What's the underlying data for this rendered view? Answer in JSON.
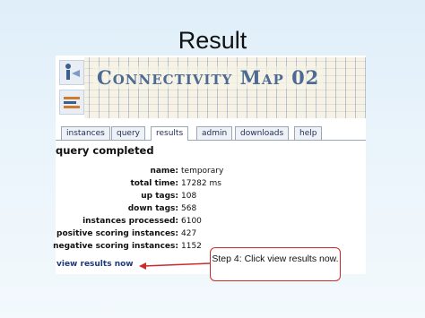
{
  "slide": {
    "title": "Result"
  },
  "app": {
    "brand": "Connectivity Map 02",
    "tabs": [
      {
        "label": "instances"
      },
      {
        "label": "query"
      },
      {
        "label": "results",
        "active": true
      },
      {
        "label": "admin"
      },
      {
        "label": "downloads"
      },
      {
        "label": "help"
      }
    ]
  },
  "results": {
    "heading": "query completed",
    "fields": [
      {
        "key": "name:",
        "value": "temporary"
      },
      {
        "key": "total time:",
        "value": "17282 ms"
      },
      {
        "key": "up tags:",
        "value": "108"
      },
      {
        "key": "down tags:",
        "value": "568"
      },
      {
        "key": "instances processed:",
        "value": "6100"
      },
      {
        "key": "positive scoring instances:",
        "value": "427"
      },
      {
        "key": "negative scoring instances:",
        "value": "1152"
      }
    ],
    "link": "view results now"
  },
  "callout": {
    "text": "Step 4: Click view results now."
  },
  "colors": {
    "accent_red": "#cc2b2b",
    "link_blue": "#1f3a7a",
    "brand_blue": "#4f6a92"
  }
}
